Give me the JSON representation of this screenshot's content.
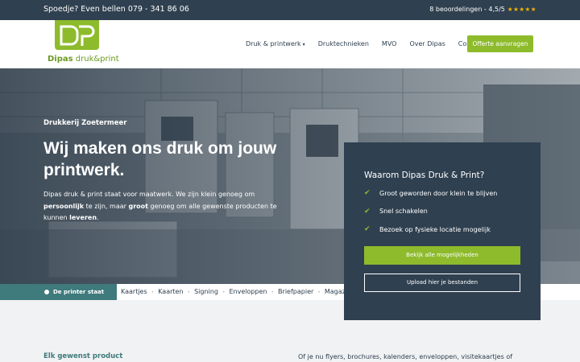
{
  "topbar": {
    "phone_text": "Spoedje? Even bellen 079 - 341 86 06",
    "reviews_text": "8 beoordelingen - 4,5/5",
    "stars": "★★★★★",
    "star_color": "#f5b400"
  },
  "header": {
    "logo_name": "Dipas",
    "logo_suffix": "druk&print",
    "nav": [
      {
        "label": "Druk & printwerk",
        "caret": "▾"
      },
      {
        "label": "Druktechnieken"
      },
      {
        "label": "MVO"
      },
      {
        "label": "Over Dipas"
      },
      {
        "label": "Contact"
      }
    ],
    "cta_label": "Offerte aanvragen"
  },
  "hero": {
    "kicker": "Drukkerij Zoetermeer",
    "title": "Wij maken ons druk om jouw printwerk.",
    "body_parts": {
      "p1": "Dipas druk & print staat voor maatwerk. We zijn klein genoeg om ",
      "b1": "persoonlijk",
      "p2": " te zijn, maar ",
      "b2": "groot",
      "p3": " genoeg om alle gewenste producten te kunnen ",
      "b3": "leveren",
      "p4": "."
    }
  },
  "catbar": {
    "printer_label": "De printer staat aan",
    "categories": [
      "Kaartjes",
      "Kaarten",
      "Signing",
      "Enveloppen",
      "Briefpapier",
      "Magazi"
    ]
  },
  "infobox": {
    "title": "Waarom Dipas Druk & Print?",
    "items": [
      "Groot geworden door klein te blijven",
      "Snel schakelen",
      "Bezoek op fysieke locatie mogelijk"
    ],
    "button_primary": "Bekijk alle mogelijkheden",
    "button_secondary": "Upload hier je bestanden"
  },
  "bottom": {
    "left_heading": "Elk gewenst product",
    "right_text": "Of je nu flyers, brochures, kalenders, enveloppen, visitekaartjes of"
  },
  "colors": {
    "brand_green": "#8dbb2c",
    "navy": "#2f4050",
    "teal": "#3f7a7c"
  }
}
